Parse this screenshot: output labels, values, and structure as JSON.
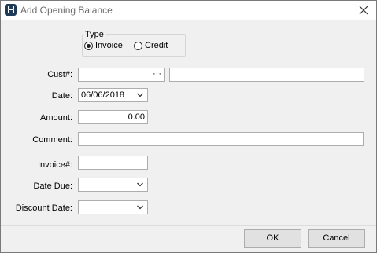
{
  "window": {
    "title": "Add Opening Balance"
  },
  "type_group": {
    "legend": "Type",
    "options": [
      {
        "label": "Invoice",
        "selected": true
      },
      {
        "label": "Credit",
        "selected": false
      }
    ]
  },
  "form": {
    "cust_label": "Cust#:",
    "cust_value": "",
    "cust_lookup": "···",
    "cust_name_value": "",
    "date_label": "Date:",
    "date_value": "06/06/2018",
    "amount_label": "Amount:",
    "amount_value": "0.00",
    "comment_label": "Comment:",
    "comment_value": "",
    "invoice_label": "Invoice#:",
    "invoice_value": "",
    "date_due_label": "Date Due:",
    "date_due_value": "",
    "discount_date_label": "Discount Date:",
    "discount_date_value": ""
  },
  "buttons": {
    "ok": "OK",
    "cancel": "Cancel"
  },
  "colors": {
    "title_text": "#6d6d6d",
    "dialog_bg": "#f0f0f0",
    "input_border": "#adadad"
  }
}
